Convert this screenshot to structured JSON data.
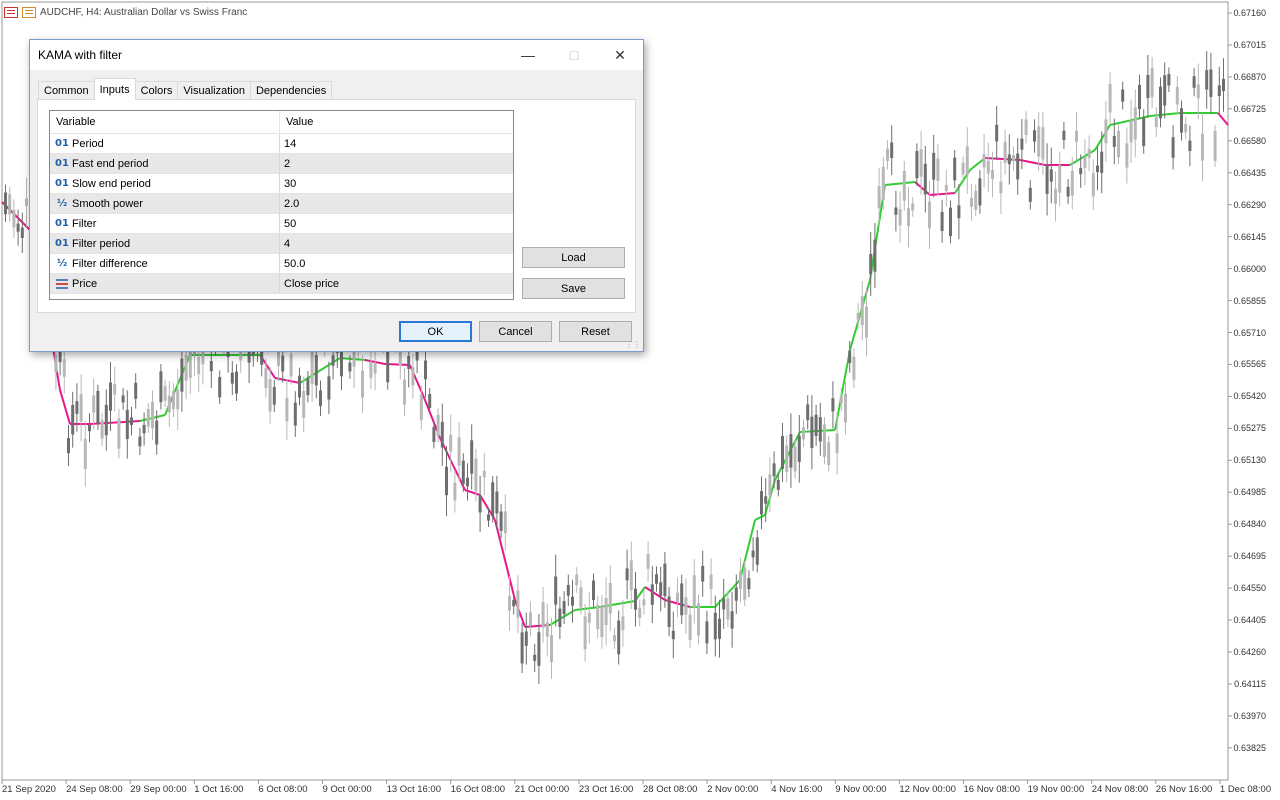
{
  "chart": {
    "symbol_header": "AUDCHF, H4:  Australian Dollar vs Swiss  Franc",
    "price_labels": [
      "0.67160",
      "0.67015",
      "0.66870",
      "0.66725",
      "0.66580",
      "0.66435",
      "0.66290",
      "0.66145",
      "0.66000",
      "0.65855",
      "0.65710",
      "0.65565",
      "0.65420",
      "0.65275",
      "0.65130",
      "0.64985",
      "0.64840",
      "0.64695",
      "0.64550",
      "0.64405",
      "0.64260",
      "0.64115",
      "0.63970",
      "0.63825"
    ],
    "date_labels": [
      "21 Sep 2020",
      "24 Sep 08:00",
      "29 Sep 00:00",
      "1 Oct 16:00",
      "6 Oct 08:00",
      "9 Oct 00:00",
      "13 Oct 16:00",
      "16 Oct 08:00",
      "21 Oct 00:00",
      "23 Oct 16:00",
      "28 Oct 08:00",
      "2 Nov 00:00",
      "4 Nov 16:00",
      "9 Nov 00:00",
      "12 Nov 00:00",
      "16 Nov 08:00",
      "19 Nov 00:00",
      "24 Nov 08:00",
      "26 Nov 16:00",
      "1 Dec 08:00"
    ],
    "colors": {
      "up_line": "#32cd32",
      "down_line": "#e8178c",
      "candle_light": "#b8b8b8",
      "candle_dark": "#6e6e6e"
    }
  },
  "dialog": {
    "title": "KAMA with filter",
    "tabs": [
      "Common",
      "Inputs",
      "Colors",
      "Visualization",
      "Dependencies"
    ],
    "active_tab": "Inputs",
    "columns": {
      "variable": "Variable",
      "value": "Value"
    },
    "rows": [
      {
        "icon": "01",
        "variable": "Period",
        "value": "14"
      },
      {
        "icon": "01",
        "variable": "Fast end period",
        "value": "2"
      },
      {
        "icon": "01",
        "variable": "Slow end period",
        "value": "30"
      },
      {
        "icon": "½",
        "variable": "Smooth power",
        "value": "2.0"
      },
      {
        "icon": "01",
        "variable": "Filter",
        "value": "50"
      },
      {
        "icon": "01",
        "variable": "Filter period",
        "value": "4"
      },
      {
        "icon": "½",
        "variable": "Filter difference",
        "value": "50.0"
      },
      {
        "icon": "price",
        "variable": "Price",
        "value": "Close price"
      }
    ],
    "buttons": {
      "load": "Load",
      "save": "Save",
      "ok": "OK",
      "cancel": "Cancel",
      "reset": "Reset"
    }
  }
}
